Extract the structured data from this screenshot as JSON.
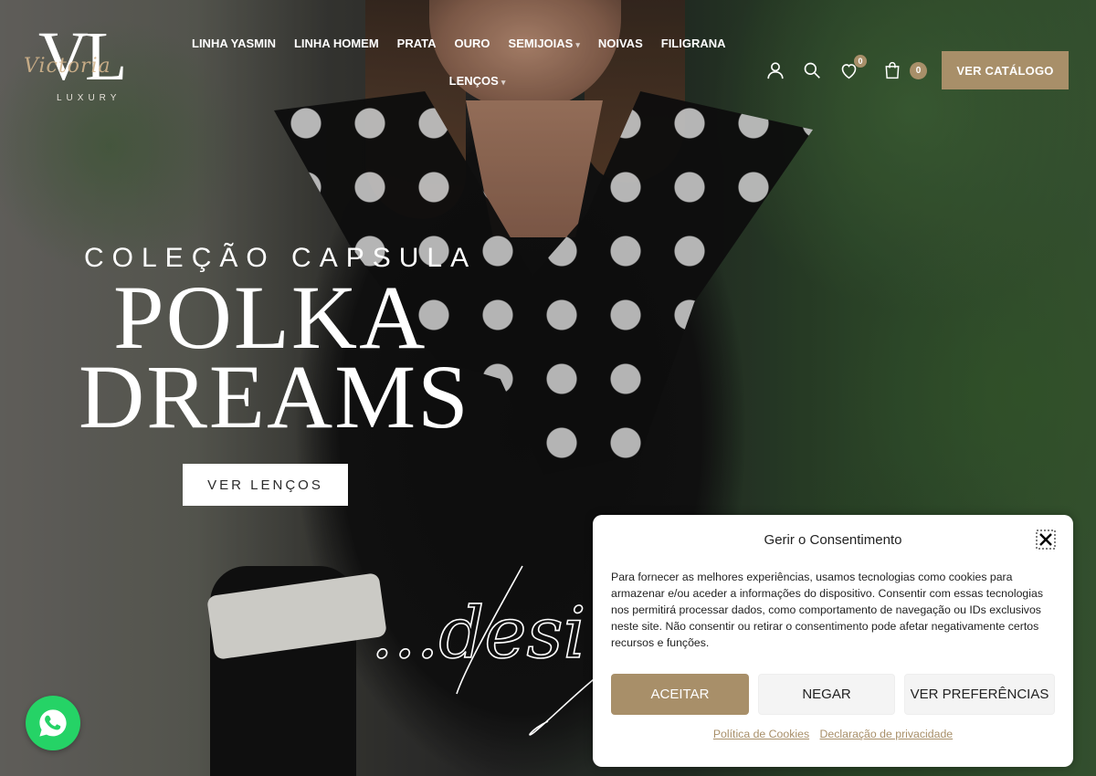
{
  "brand": {
    "logo_letters": "VL",
    "logo_script": "Victoria",
    "logo_sub": "LUXURY"
  },
  "nav": {
    "items": [
      "LINHA YASMIN",
      "LINHA HOMEM",
      "PRATA",
      "OURO",
      "SEMIJOIAS",
      "NOIVAS",
      "FILIGRANA"
    ],
    "row2": "LENÇOS"
  },
  "header_icons": {
    "account": "user-icon",
    "search": "search-icon",
    "wishlist": "heart-icon",
    "wishlist_count": "0",
    "cart": "shopping-bag-icon",
    "cart_count": "0",
    "catalog_button": "VER CATÁLOGO"
  },
  "hero": {
    "kicker": "COLEÇÃO CAPSULA",
    "title_line1": "POLKA",
    "title_line2": "DREAMS",
    "cta": "VER LENÇOS",
    "script_text": "...desi"
  },
  "consent": {
    "title": "Gerir o Consentimento",
    "body": "Para fornecer as melhores experiências, usamos tecnologias como cookies para armazenar e/ou aceder a informações do dispositivo. Consentir com essas tecnologias nos permitirá processar dados, como comportamento de navegação ou IDs exclusivos neste site. Não consentir ou retirar o consentimento pode afetar negativamente certos recursos e funções.",
    "accept": "ACEITAR",
    "deny": "NEGAR",
    "preferences": "VER PREFERÊNCIAS",
    "link_cookies": "Política de Cookies",
    "link_privacy": "Declaração de privacidade"
  },
  "colors": {
    "accent": "#a88f69",
    "whatsapp": "#25d366"
  }
}
